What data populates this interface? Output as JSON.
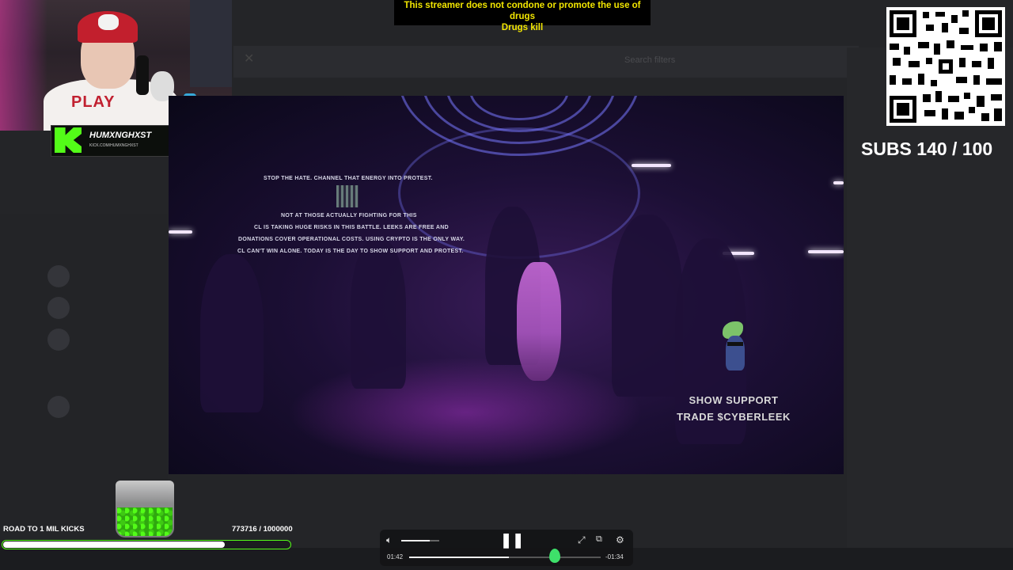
{
  "disclaimer": {
    "line1": "This streamer does not condone or promote the use of drugs",
    "line2": "Drugs kill"
  },
  "kick_badge": {
    "name": "HUMXNGHXST",
    "url": "KICK.COM/HUMXNGHXST"
  },
  "qr": {
    "label": "SUBS 140 / 100"
  },
  "video_overlay": {
    "line1": "STOP THE HATE. CHANNEL THAT ENERGY INTO PROTEST.",
    "line2": "NOT AT THOSE ACTUALLY FIGHTING FOR THIS",
    "line3": "CL IS TAKING HUGE RISKS IN THIS BATTLE. LEEKS ARE FREE AND",
    "line4": "DONATIONS COVER OPERATIONAL COSTS. USING CRYPTO IS THE ONLY WAY.",
    "line5": "CL CAN'T WIN ALONE. TODAY IS THE DAY TO SHOW SUPPORT AND PROTEST.",
    "support1": "SHOW SUPPORT",
    "support2": "TRADE $CYBERLEEK"
  },
  "road_to_kicks": {
    "label": "ROAD TO 1 MIL KICKS",
    "count": "773716 / 1000000",
    "progress": 0.774
  },
  "player": {
    "elapsed": "01:42",
    "remaining": "-01:34",
    "progress": 0.52,
    "volume": 0.75,
    "icons": {
      "volume": "volume-icon",
      "pause": "pause-icon",
      "expand": "expand-icon",
      "pip": "picture-in-picture-icon",
      "settings": "settings-hd-icon"
    }
  },
  "background_app": {
    "search_filters": "Search filters"
  },
  "colors": {
    "kick_green": "#53fc18",
    "disclaimer_yellow": "#f2e600",
    "bar_fill": "#ffffff"
  }
}
